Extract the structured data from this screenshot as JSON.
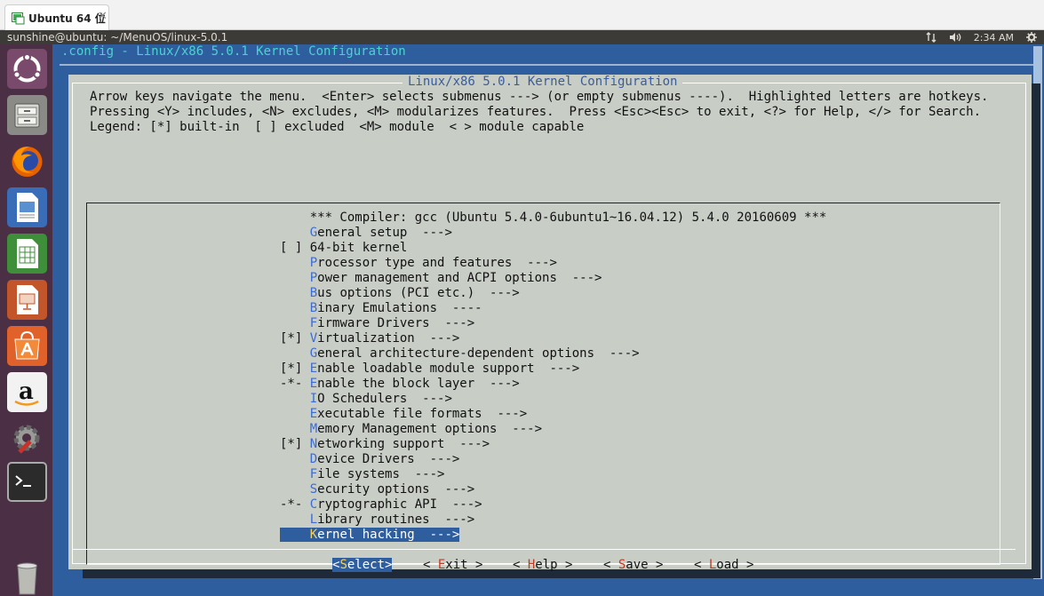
{
  "vm_tab": {
    "label": "Ubuntu 64 位",
    "close": "✕"
  },
  "top_panel": {
    "title": "sunshine@ubuntu: ~/MenuOS/linux-5.0.1",
    "time": "2:34 AM"
  },
  "launcher": [
    "ubuntu-dash-icon",
    "files-icon",
    "firefox-icon",
    "writer-icon",
    "calc-icon",
    "impress-icon",
    "software-center-icon",
    "amazon-icon",
    "settings-icon",
    "terminal-icon",
    "trash-icon"
  ],
  "terminal": {
    "title": ".config - Linux/x86 5.0.1 Kernel Configuration"
  },
  "dialog": {
    "title": "Linux/x86 5.0.1 Kernel Configuration",
    "help": [
      "Arrow keys navigate the menu.  <Enter> selects submenus ---> (or empty submenus ----).  Highlighted letters are hotkeys.",
      "Pressing <Y> includes, <N> excludes, <M> modularizes features.  Press <Esc><Esc> to exit, <?> for Help, </> for Search.",
      "Legend: [*] built-in  [ ] excluded  <M> module  < > module capable"
    ]
  },
  "menu": {
    "items": [
      {
        "prefix": "    ",
        "hotkey": "",
        "rest": "*** Compiler: gcc (Ubuntu 5.4.0-6ubuntu1~16.04.12) 5.4.0 20160609 ***",
        "selected": false
      },
      {
        "prefix": "    ",
        "hotkey": "G",
        "rest": "eneral setup  --->",
        "selected": false
      },
      {
        "prefix": "[ ] ",
        "hotkey": "",
        "rest": "64-bit kernel",
        "selected": false
      },
      {
        "prefix": "    ",
        "hotkey": "P",
        "rest": "rocessor type and features  --->",
        "selected": false
      },
      {
        "prefix": "    ",
        "hotkey": "P",
        "rest": "ower management and ACPI options  --->",
        "selected": false
      },
      {
        "prefix": "    ",
        "hotkey": "B",
        "rest": "us options (PCI etc.)  --->",
        "selected": false
      },
      {
        "prefix": "    ",
        "hotkey": "B",
        "rest": "inary Emulations  ----",
        "selected": false
      },
      {
        "prefix": "    ",
        "hotkey": "F",
        "rest": "irmware Drivers  --->",
        "selected": false
      },
      {
        "prefix": "[*] ",
        "hotkey": "V",
        "rest": "irtualization  --->",
        "selected": false
      },
      {
        "prefix": "    ",
        "hotkey": "G",
        "rest": "eneral architecture-dependent options  --->",
        "selected": false
      },
      {
        "prefix": "[*] ",
        "hotkey": "E",
        "rest": "nable loadable module support  --->",
        "selected": false
      },
      {
        "prefix": "-*- ",
        "hotkey": "E",
        "rest": "nable the block layer  --->",
        "selected": false
      },
      {
        "prefix": "    ",
        "hotkey": "I",
        "rest": "O Schedulers  --->",
        "selected": false
      },
      {
        "prefix": "    ",
        "hotkey": "E",
        "rest": "xecutable file formats  --->",
        "selected": false
      },
      {
        "prefix": "    ",
        "hotkey": "M",
        "rest": "emory Management options  --->",
        "selected": false
      },
      {
        "prefix": "[*] ",
        "hotkey": "N",
        "rest": "etworking support  --->",
        "selected": false
      },
      {
        "prefix": "    ",
        "hotkey": "D",
        "rest": "evice Drivers  --->",
        "selected": false
      },
      {
        "prefix": "    ",
        "hotkey": "F",
        "rest": "ile systems  --->",
        "selected": false
      },
      {
        "prefix": "    ",
        "hotkey": "S",
        "rest": "ecurity options  --->",
        "selected": false
      },
      {
        "prefix": "-*- ",
        "hotkey": "C",
        "rest": "ryptographic API  --->",
        "selected": false
      },
      {
        "prefix": "    ",
        "hotkey": "L",
        "rest": "ibrary routines  --->",
        "selected": false
      },
      {
        "prefix": "    ",
        "hotkey": "K",
        "rest": "ernel hacking  --->",
        "selected": true
      }
    ]
  },
  "buttons": [
    {
      "pre": "<",
      "hotkey": "S",
      "post": "elect>",
      "active": true
    },
    {
      "pre": "< ",
      "hotkey": "E",
      "post": "xit >",
      "active": false
    },
    {
      "pre": "< ",
      "hotkey": "H",
      "post": "elp >",
      "active": false
    },
    {
      "pre": "< ",
      "hotkey": "S",
      "post": "ave >",
      "active": false
    },
    {
      "pre": "< ",
      "hotkey": "L",
      "post": "oad >",
      "active": false
    }
  ],
  "colors": {
    "terminal_bg": "#2f5e9f",
    "dialog_bg": "#c8cdc6",
    "hotkey": "#3b6bd6",
    "button_hotkey": "#c23b22",
    "launcher_bg": "#4b2f45"
  }
}
